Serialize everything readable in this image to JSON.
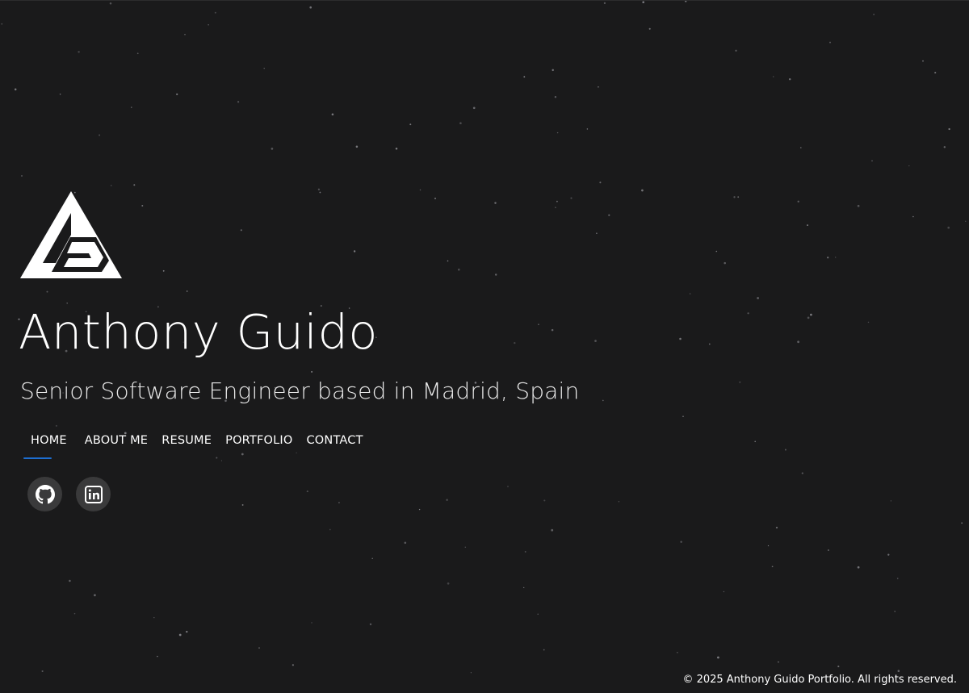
{
  "profile": {
    "name": "Anthony Guido",
    "tagline": "Senior Software Engineer based in Madrid, Spain",
    "logo_icon": "ag-triangle-logo"
  },
  "nav": {
    "items": [
      {
        "label": "HOME",
        "active": true
      },
      {
        "label": "ABOUT ME",
        "active": false
      },
      {
        "label": "RESUME",
        "active": false
      },
      {
        "label": "PORTFOLIO",
        "active": false
      },
      {
        "label": "CONTACT",
        "active": false
      }
    ],
    "active_color": "#1d6ed0"
  },
  "socials": [
    {
      "icon": "github-icon"
    },
    {
      "icon": "linkedin-icon"
    }
  ],
  "footer": {
    "text": "© 2025 Anthony Guido Portfolio. All rights reserved."
  },
  "colors": {
    "background": "#1a1a1b",
    "text": "#ffffff",
    "social_bg": "#3a3a3b",
    "accent": "#1d6ed0"
  }
}
